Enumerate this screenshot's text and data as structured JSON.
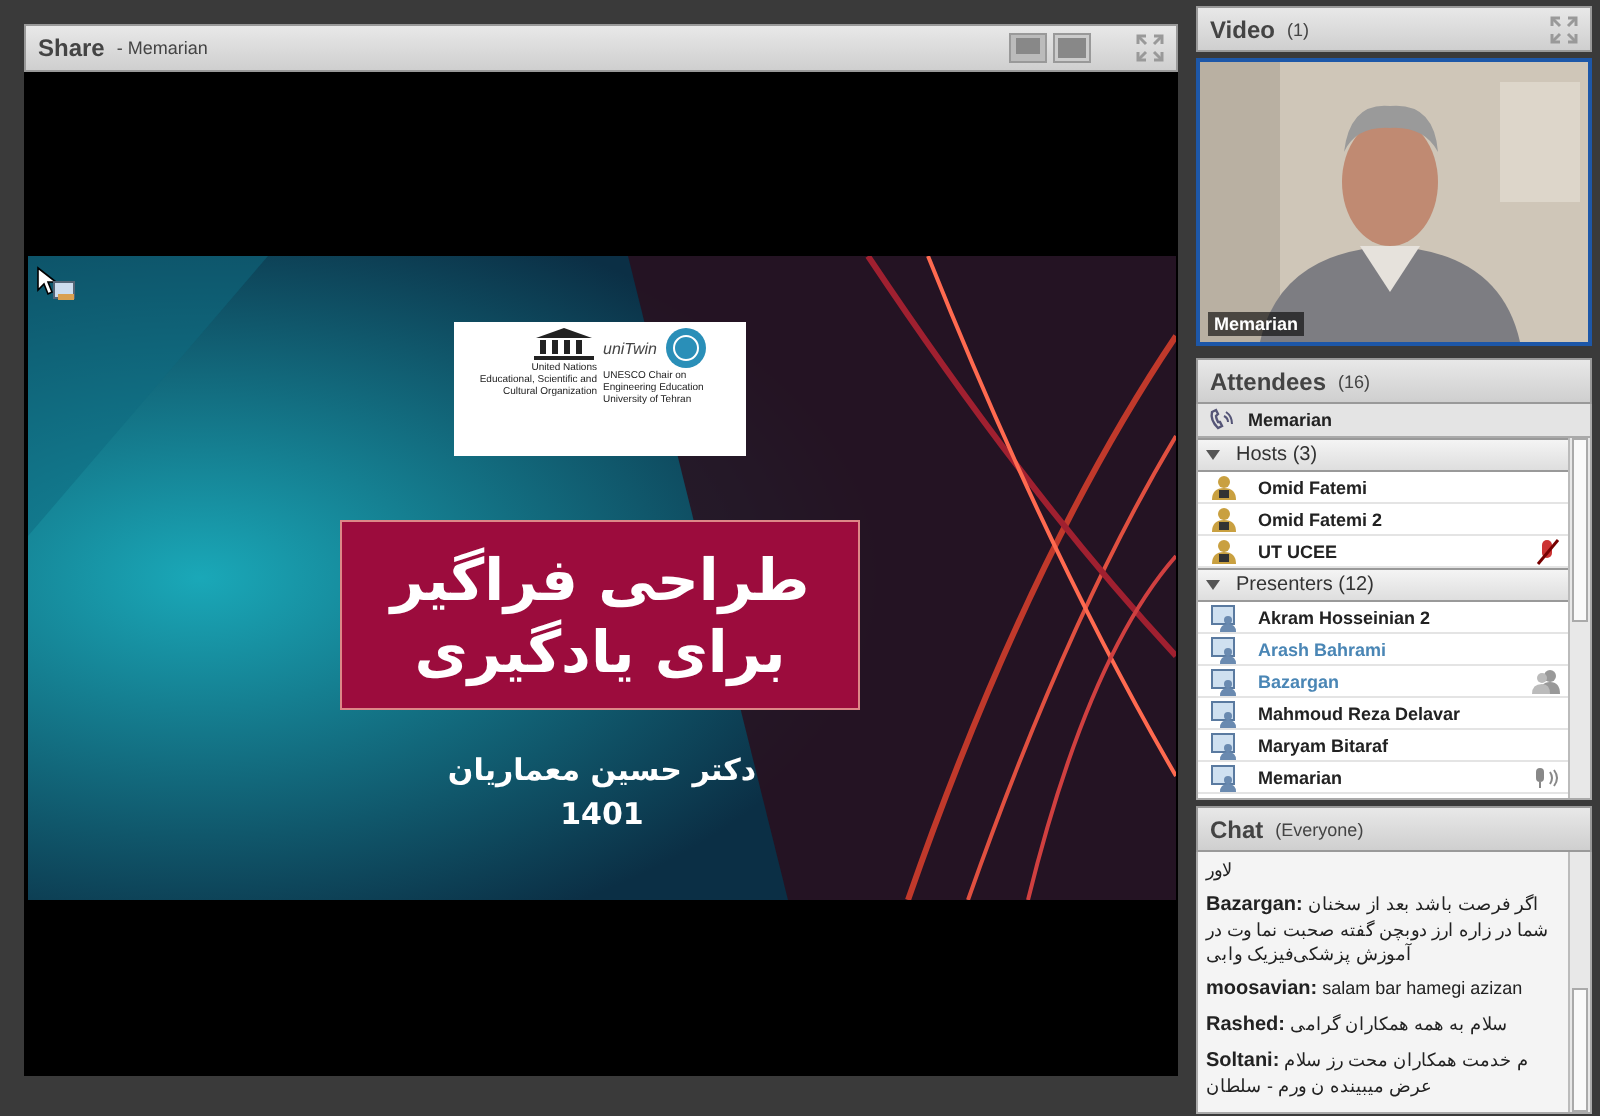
{
  "share": {
    "title": "Share",
    "presenter": "- Memarian",
    "slide": {
      "org_left": [
        "United Nations",
        "Educational, Scientific and",
        "Cultural Organization"
      ],
      "org_brand": "uniTwin",
      "org_right": [
        "UNESCO Chair on",
        "Engineering Education",
        "University of Tehran"
      ],
      "title_lines": [
        "طراحی فراگیر",
        "برای یادگیری"
      ],
      "author": "دکتر حسین معماریان",
      "year": "1401"
    }
  },
  "video": {
    "title": "Video",
    "count": "(1)",
    "name": "Memarian"
  },
  "attendees": {
    "title": "Attendees",
    "count": "(16)",
    "phone_user": "Memarian",
    "groups": [
      {
        "label": "Hosts (3)",
        "expanded": true,
        "children": [
          {
            "name": "Omid Fatemi",
            "kind": "host",
            "highlighted": false
          },
          {
            "name": "Omid Fatemi 2",
            "kind": "host",
            "highlighted": false
          },
          {
            "name": "UT UCEE",
            "kind": "host",
            "highlighted": false,
            "badge": {
              "kind": "mic_off"
            }
          }
        ]
      },
      {
        "label": "Presenters (12)",
        "expanded": true,
        "children": [
          {
            "name": "Akram Hosseinian 2",
            "kind": "presenter",
            "highlighted": false
          },
          {
            "name": "Arash Bahrami",
            "kind": "presenter",
            "highlighted": true
          },
          {
            "name": "Bazargan",
            "kind": "presenter",
            "highlighted": true,
            "badge": {
              "kind": "camera"
            }
          },
          {
            "name": "Mahmoud Reza Delavar",
            "kind": "presenter",
            "highlighted": false
          },
          {
            "name": "Maryam Bitaraf",
            "kind": "presenter",
            "highlighted": false
          },
          {
            "name": "Memarian",
            "kind": "presenter",
            "highlighted": false,
            "badge": {
              "kind": "speaking"
            }
          }
        ]
      }
    ]
  },
  "chat": {
    "title": "Chat",
    "scope": "(Everyone)",
    "messages": [
      "لاور",
      "**Bazargan:** اگر فرصت باشد بعد از سخنان شما در زاره ارز دوبچن گفته صحبت نما وت در آموزش پزشکی‌فیزیک وابی",
      "**moosavian:** salam bar hamegi azizan",
      "**Rashed:** سلام به همه همکاران گرامی",
      "**Soltani:** م خدمت همکاران محت رز سلام عرض میبینده ن ورم - سلطان"
    ]
  }
}
